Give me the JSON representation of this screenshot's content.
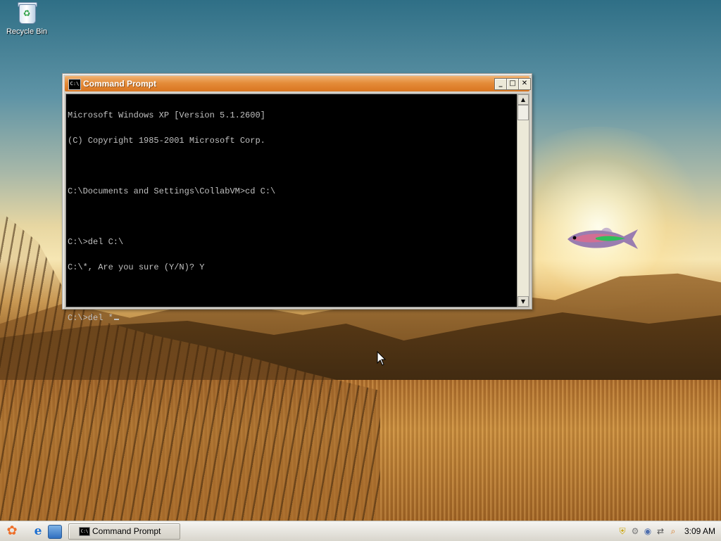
{
  "desktop": {
    "icons": [
      {
        "label": "Recycle Bin",
        "icon": "recycle-bin-icon"
      }
    ]
  },
  "window": {
    "title": "Command Prompt",
    "icon": "cmd-icon",
    "buttons": {
      "minimize": "_",
      "maximize": "□",
      "close": "✕"
    },
    "console_lines": [
      "Microsoft Windows XP [Version 5.1.2600]",
      "(C) Copyright 1985-2001 Microsoft Corp.",
      "",
      "C:\\Documents and Settings\\CollabVM>cd C:\\",
      "",
      "C:\\>del C:\\",
      "C:\\*, Are you sure (Y/N)? Y",
      "",
      "C:\\>del *"
    ]
  },
  "taskbar": {
    "task_buttons": [
      {
        "label": "Command Prompt",
        "icon": "cmd-icon"
      }
    ],
    "quick_launch": [
      "internet-explorer-icon",
      "show-desktop-icon"
    ],
    "tray_icons": [
      "security-shield-icon",
      "settings-gear-icon",
      "volume-icon",
      "network-icon",
      "search-icon"
    ],
    "clock": "3:09 AM"
  }
}
